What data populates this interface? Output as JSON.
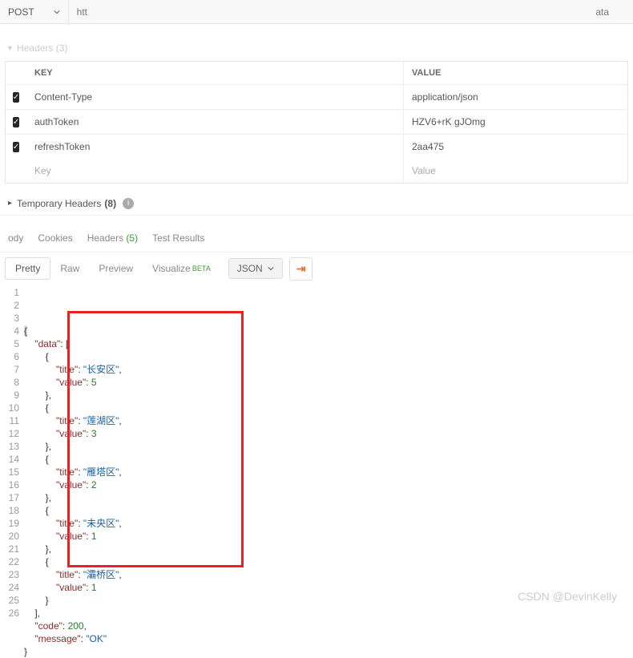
{
  "url_bar": {
    "method": "POST",
    "url_prefix": "htt",
    "url_suffix": "ata"
  },
  "headers_section": {
    "collapse_label": "Headers (3)",
    "key_label": "KEY",
    "value_label": "VALUE",
    "rows": [
      {
        "checked": true,
        "key": "Content-Type",
        "value": "application/json"
      },
      {
        "checked": true,
        "key": "authToken",
        "value": "HZV6+rK                        gJOmg"
      },
      {
        "checked": true,
        "key": "refreshToken",
        "value": "2aa475"
      }
    ],
    "placeholder_key": "Key",
    "placeholder_value": "Value"
  },
  "temp_headers": {
    "label": "Temporary Headers",
    "count": "(8)"
  },
  "response_tabs": {
    "body": "ody",
    "cookies": "Cookies",
    "headers": "Headers",
    "headers_count": "(5)",
    "test_results": "Test Results"
  },
  "toolbar": {
    "pretty": "Pretty",
    "raw": "Raw",
    "preview": "Preview",
    "visualize": "Visualize",
    "beta": "BETA",
    "json": "JSON"
  },
  "code": {
    "lines": [
      "{",
      "    \"data\": [",
      "        {",
      "            \"title\": \"长安区\",",
      "            \"value\": 5",
      "        },",
      "        {",
      "            \"title\": \"莲湖区\",",
      "            \"value\": 3",
      "        },",
      "        {",
      "            \"title\": \"雁塔区\",",
      "            \"value\": 2",
      "        },",
      "        {",
      "            \"title\": \"未央区\",",
      "            \"value\": 1",
      "        },",
      "        {",
      "            \"title\": \"灞桥区\",",
      "            \"value\": 1",
      "        }",
      "    ],",
      "    \"code\": 200,",
      "    \"message\": \"OK\"",
      "}"
    ],
    "line_count": 26
  },
  "watermark": "CSDN @DevinKelly"
}
